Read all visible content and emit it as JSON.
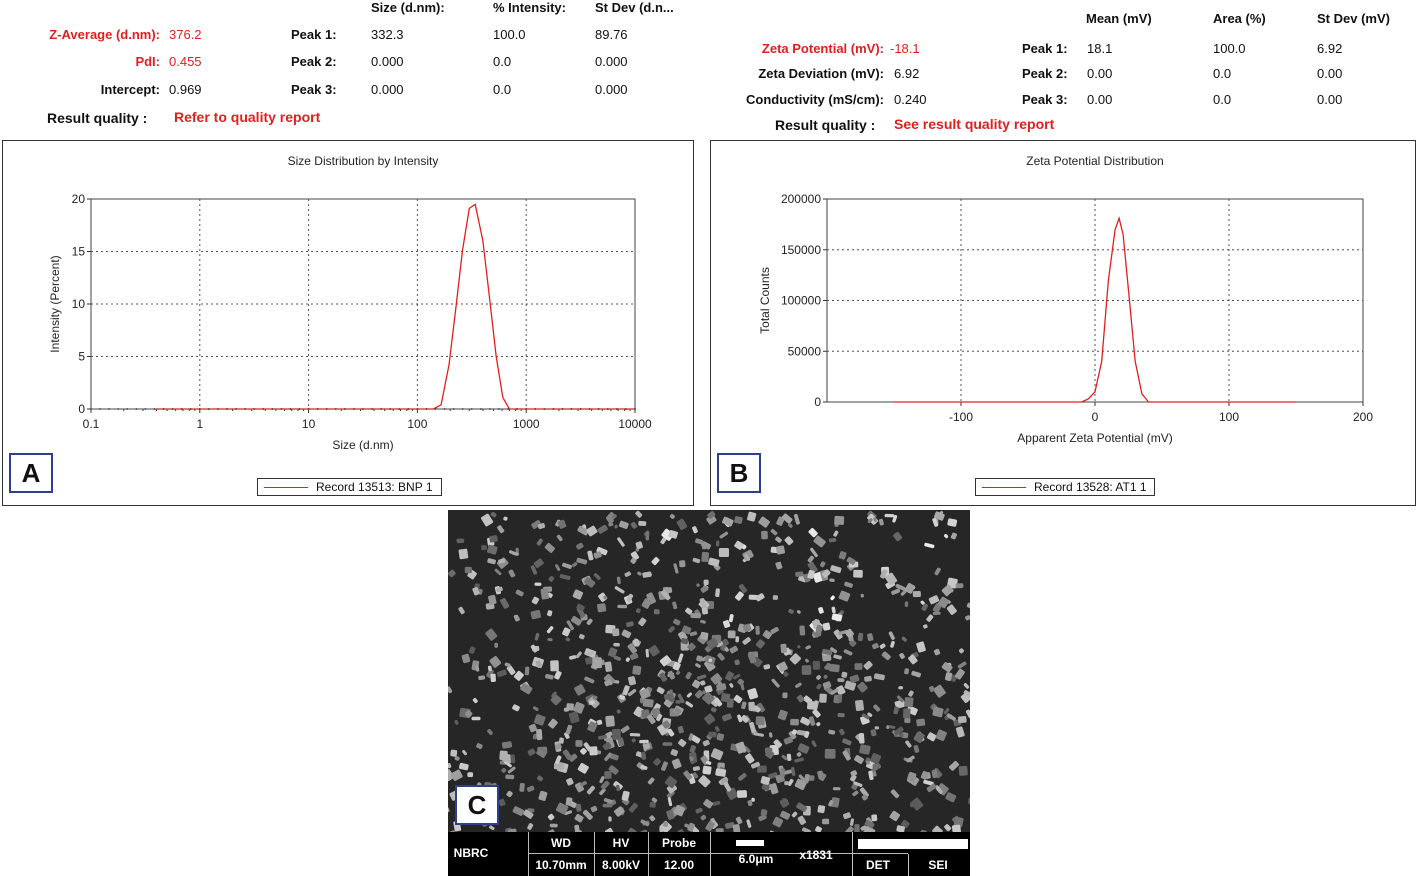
{
  "sizeResults": {
    "columns": [
      "Size (d.nm):",
      "% Intensity:",
      "St Dev (d.n..."
    ],
    "zAverageLabel": "Z-Average (d.nm):",
    "zAverageValue": "376.2",
    "pdiLabel": "PdI:",
    "pdiValue": "0.455",
    "interceptLabel": "Intercept:",
    "interceptValue": "0.969",
    "qualityLabel": "Result quality :",
    "qualityValue": "Refer to quality report",
    "peaks": [
      {
        "label": "Peak 1:",
        "size": "332.3",
        "intensity": "100.0",
        "stdev": "89.76"
      },
      {
        "label": "Peak 2:",
        "size": "0.000",
        "intensity": "0.0",
        "stdev": "0.000"
      },
      {
        "label": "Peak 3:",
        "size": "0.000",
        "intensity": "0.0",
        "stdev": "0.000"
      }
    ]
  },
  "zetaResults": {
    "columns": [
      "Mean (mV)",
      "Area (%)",
      "St Dev (mV)"
    ],
    "zetaLabel": "Zeta Potential (mV):",
    "zetaValue": "-18.1",
    "deviationLabel": "Zeta Deviation (mV):",
    "deviationValue": "6.92",
    "conductivityLabel": "Conductivity (mS/cm):",
    "conductivityValue": "0.240",
    "qualityLabel": "Result quality :",
    "qualityValue": "See result quality report",
    "peaks": [
      {
        "label": "Peak 1:",
        "mean": "18.1",
        "area": "100.0",
        "stdev": "6.92"
      },
      {
        "label": "Peak 2:",
        "mean": "0.00",
        "area": "0.0",
        "stdev": "0.00"
      },
      {
        "label": "Peak 3:",
        "mean": "0.00",
        "area": "0.0",
        "stdev": "0.00"
      }
    ]
  },
  "panelLabels": {
    "a": "A",
    "b": "B",
    "c": "C"
  },
  "colors": {
    "accent": "#e0201f",
    "badgeBorder": "#2e3f8f"
  },
  "chart_data": [
    {
      "type": "line",
      "title": "Size Distribution by Intensity",
      "xlabel": "Size (d.nm)",
      "ylabel": "Intensity (Percent)",
      "xscale": "log",
      "xlim": [
        0.1,
        10000
      ],
      "ylim": [
        0,
        20
      ],
      "xticks": [
        0.1,
        1,
        10,
        100,
        1000,
        10000
      ],
      "xtickLabels": [
        "0.1",
        "1",
        "10",
        "100",
        "1000",
        "10000"
      ],
      "yticks": [
        0,
        5,
        10,
        15,
        20
      ],
      "ytickLabels": [
        "0",
        "5",
        "10",
        "15",
        "20"
      ],
      "grid": true,
      "legendPlacement": "bottom",
      "series": [
        {
          "name": "Record 13513: BNP 1",
          "color": "#e0201f",
          "x": [
            0.4,
            1,
            10,
            100,
            140,
            165,
            195,
            225,
            260,
            300,
            340,
            400,
            460,
            530,
            610,
            700,
            1000,
            10000
          ],
          "y": [
            0,
            0,
            0,
            0,
            0,
            0.4,
            4.2,
            9.5,
            15.1,
            19.1,
            19.5,
            16.0,
            10.6,
            5.0,
            1.1,
            0,
            0,
            0
          ]
        }
      ]
    },
    {
      "type": "line",
      "title": "Zeta Potential Distribution",
      "xlabel": "Apparent Zeta Potential (mV)",
      "ylabel": "Total Counts",
      "xlim": [
        -200,
        200
      ],
      "ylim": [
        0,
        200000
      ],
      "xticks": [
        -100,
        0,
        100,
        200
      ],
      "xtickLabels": [
        "-100",
        "0",
        "100",
        "200"
      ],
      "yticks": [
        0,
        50000,
        100000,
        150000,
        200000
      ],
      "ytickLabels": [
        "0",
        "50000",
        "100000",
        "150000",
        "200000"
      ],
      "grid": true,
      "legendPlacement": "bottom",
      "series": [
        {
          "name": "Record 13528: AT1 1",
          "color": "#e0201f",
          "x": [
            -150,
            -10,
            -5,
            0,
            5,
            10,
            15,
            18,
            21,
            25,
            30,
            35,
            40,
            150
          ],
          "y": [
            0,
            0,
            3000,
            10000,
            40000,
            120000,
            170000,
            181000,
            165000,
            110000,
            40000,
            8000,
            0,
            0
          ]
        }
      ]
    }
  ],
  "semInfo": {
    "instrument": "NBRC",
    "wdLabel": "WD",
    "wdValue": "10.70mm",
    "hvLabel": "HV",
    "hvValue": "8.00kV",
    "probeLabel": "Probe",
    "probeValue": "12.00",
    "scale": "6.0μm",
    "magnification": "x1831",
    "detLabel": "DET",
    "detValue": "SEI"
  }
}
